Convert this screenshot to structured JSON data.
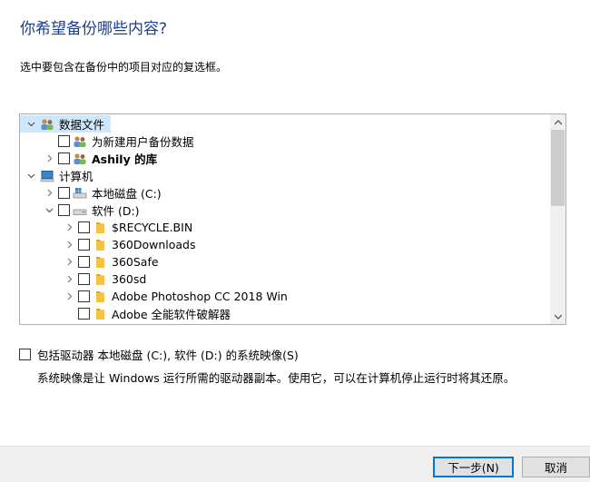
{
  "header": {
    "title": "你希望备份哪些内容?",
    "subtitle": "选中要包含在备份中的项目对应的复选框。"
  },
  "tree": {
    "items": [
      {
        "label": "数据文件",
        "expander": "expanded",
        "checkbox": false,
        "icon": "users-icon",
        "bold": false
      },
      {
        "label": "为新建用户备份数据",
        "expander": "none",
        "checkbox": true,
        "icon": "users-icon",
        "bold": false
      },
      {
        "label": "Ashily 的库",
        "expander": "collapsed",
        "checkbox": true,
        "icon": "users-icon",
        "bold": true
      },
      {
        "label": "计算机",
        "expander": "expanded",
        "checkbox": false,
        "icon": "computer-icon",
        "bold": false
      },
      {
        "label": "本地磁盘 (C:)",
        "expander": "collapsed",
        "checkbox": true,
        "icon": "windows-drive-icon",
        "bold": false
      },
      {
        "label": "软件 (D:)",
        "expander": "expanded",
        "checkbox": true,
        "icon": "drive-icon",
        "bold": false
      },
      {
        "label": "$RECYCLE.BIN",
        "expander": "collapsed",
        "checkbox": true,
        "icon": "folder-icon",
        "bold": false
      },
      {
        "label": "360Downloads",
        "expander": "collapsed",
        "checkbox": true,
        "icon": "folder-icon",
        "bold": false
      },
      {
        "label": "360Safe",
        "expander": "collapsed",
        "checkbox": true,
        "icon": "folder-icon",
        "bold": false
      },
      {
        "label": "360sd",
        "expander": "collapsed",
        "checkbox": true,
        "icon": "folder-icon",
        "bold": false
      },
      {
        "label": "Adobe Photoshop CC 2018 Win",
        "expander": "collapsed",
        "checkbox": true,
        "icon": "folder-icon",
        "bold": false
      },
      {
        "label": "Adobe 全能软件破解器",
        "expander": "none",
        "checkbox": true,
        "icon": "folder-icon",
        "bold": false
      }
    ]
  },
  "system_image": {
    "label": "包括驱动器 本地磁盘 (C:), 软件 (D:) 的系统映像(S)",
    "description": "系统映像是让 Windows 运行所需的驱动器副本。使用它，可以在计算机停止运行时将其还原。"
  },
  "footer": {
    "next_label": "下一步(N)",
    "cancel_label": "取消"
  },
  "colors": {
    "title": "#1b3f91",
    "selection": "#cce8ff",
    "folder": "#f5c242",
    "accent": "#0078d7"
  }
}
